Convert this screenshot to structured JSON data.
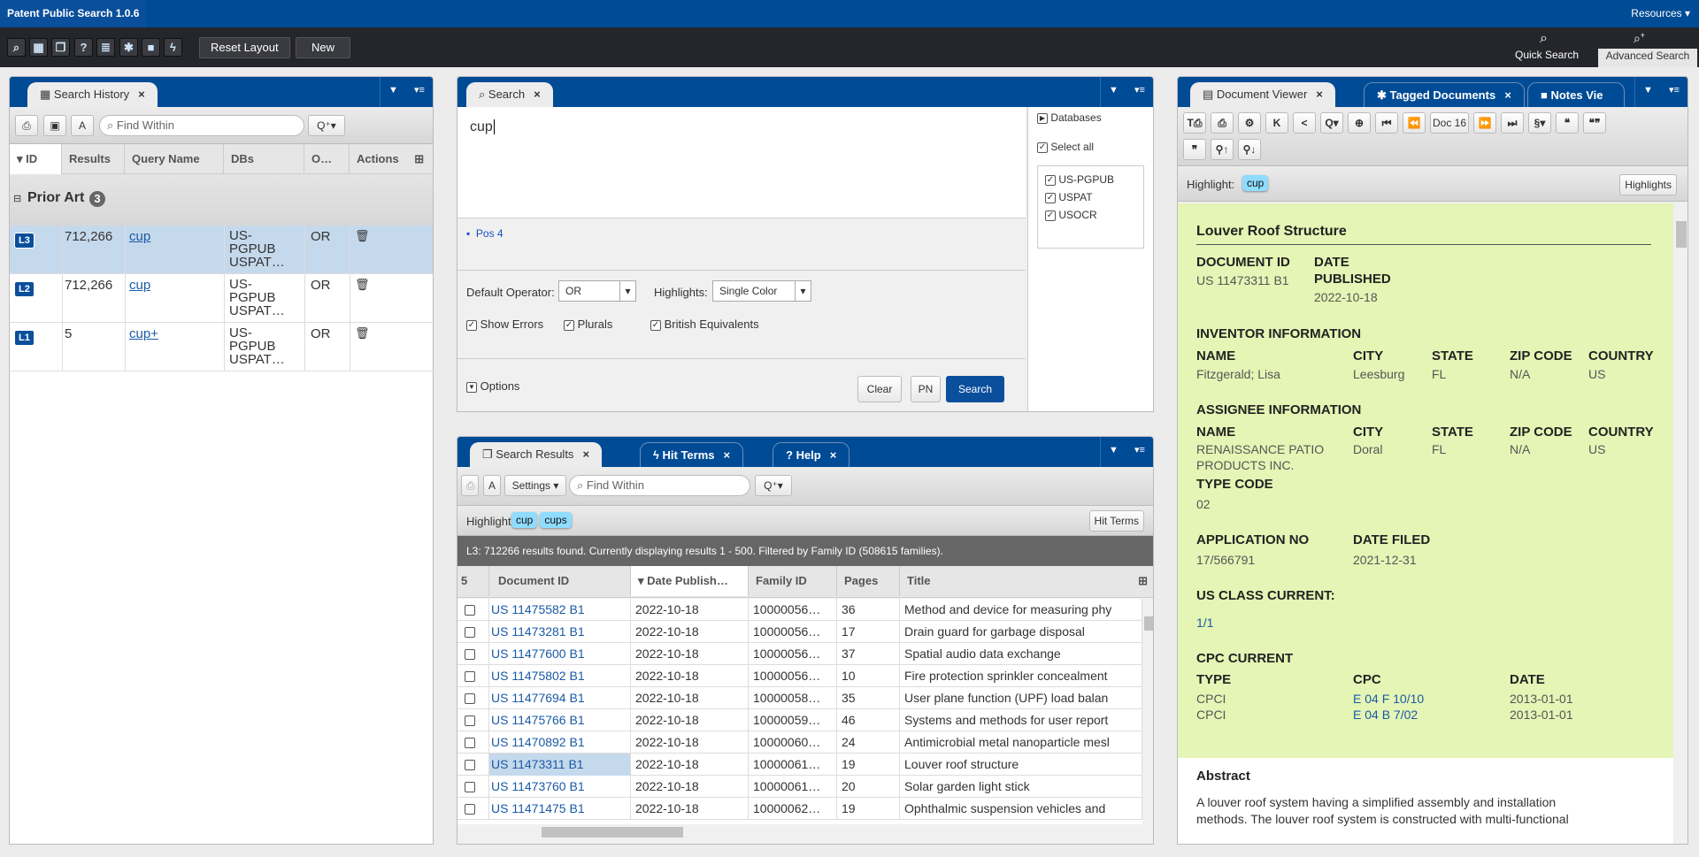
{
  "app": {
    "title": "Patent Public Search 1.0.6",
    "resources": "Resources ▾"
  },
  "toolbar": {
    "icons": [
      "search-icon",
      "search-history-icon",
      "search-results-icon",
      "help-icon",
      "document-viewer-icon",
      "tagged-documents-icon",
      "notes-icon",
      "hit-terms-icon"
    ],
    "reset_layout": "Reset Layout",
    "new": "New",
    "quick_search": "Quick Search",
    "advanced_search": "Advanced Search"
  },
  "history": {
    "tab": "Search History",
    "find_placeholder": "Find Within",
    "columns": [
      "ID",
      "Results",
      "Query Name",
      "DBs",
      "O…",
      "Actions"
    ],
    "group": "Prior Art",
    "group_count": "3",
    "rows": [
      {
        "id": "L3",
        "results": "712,266",
        "query": "cup",
        "dbs": "US-PGPUB USPAT…",
        "op": "OR",
        "selected": true
      },
      {
        "id": "L2",
        "results": "712,266",
        "query": "cup",
        "dbs": "US-PGPUB USPAT…",
        "op": "OR"
      },
      {
        "id": "L1",
        "results": "5",
        "query": "cup+",
        "dbs": "US-PGPUB USPAT…",
        "op": "OR"
      }
    ]
  },
  "search": {
    "tab": "Search",
    "query": "cup",
    "pos": "Pos 4",
    "default_operator_label": "Default Operator:",
    "default_operator": "OR",
    "highlights_label": "Highlights:",
    "highlights": "Single Color",
    "show_errors": "Show Errors",
    "plurals": "Plurals",
    "british": "British Equivalents",
    "options": "Options",
    "clear": "Clear",
    "pn": "PN",
    "search": "Search",
    "databases_label": "Databases",
    "select_all": "Select all",
    "databases": [
      "US-PGPUB",
      "USPAT",
      "USOCR"
    ]
  },
  "results": {
    "tabs": [
      "Search Results",
      "Hit Terms",
      "Help"
    ],
    "settings": "Settings",
    "find_placeholder": "Find Within",
    "highlight_label": "Highlight:",
    "highlights": [
      "cup",
      "cups"
    ],
    "hit_terms_btn": "Hit Terms",
    "status": "L3: 712266 results found. Currently displaying results 1 - 500. Filtered by Family ID (508615 families).",
    "count_col": "5",
    "columns": [
      "Document ID",
      "Date Publish…",
      "Family ID",
      "Pages",
      "Title"
    ],
    "rows": [
      [
        "US 11475582 B1",
        "2022-10-18",
        "10000056…",
        "36",
        "Method and device for measuring phy"
      ],
      [
        "US 11473281 B1",
        "2022-10-18",
        "10000056…",
        "17",
        "Drain guard for garbage disposal"
      ],
      [
        "US 11477600 B1",
        "2022-10-18",
        "10000056…",
        "37",
        "Spatial audio data exchange"
      ],
      [
        "US 11475802 B1",
        "2022-10-18",
        "10000056…",
        "10",
        "Fire protection sprinkler concealment"
      ],
      [
        "US 11477694 B1",
        "2022-10-18",
        "10000058…",
        "35",
        "User plane function (UPF) load balan"
      ],
      [
        "US 11475766 B1",
        "2022-10-18",
        "10000059…",
        "46",
        "Systems and methods for user report"
      ],
      [
        "US 11470892 B1",
        "2022-10-18",
        "10000060…",
        "24",
        "Antimicrobial metal nanoparticle mesl"
      ],
      [
        "US 11473311 B1",
        "2022-10-18",
        "10000061…",
        "19",
        "Louver roof structure"
      ],
      [
        "US 11473760 B1",
        "2022-10-18",
        "10000061…",
        "20",
        "Solar garden light stick"
      ],
      [
        "US 11471475 B1",
        "2022-10-18",
        "10000062…",
        "19",
        "Ophthalmic suspension vehicles and"
      ]
    ],
    "selected_row": 7
  },
  "viewer": {
    "tabs": [
      "Document Viewer",
      "Tagged Documents",
      "Notes Vie"
    ],
    "doc_nav": "Doc 16",
    "highlight_label": "Highlight:",
    "highlight": "cup",
    "highlights_btn": "Highlights",
    "title": "Louver Roof Structure",
    "doc_id_label": "DOCUMENT ID",
    "doc_id": "US 11473311 B1",
    "date_pub_label1": "DATE",
    "date_pub_label2": "PUBLISHED",
    "date_pub": "2022-10-18",
    "inventor_heading": "INVENTOR INFORMATION",
    "assignee_heading": "ASSIGNEE INFORMATION",
    "cols": {
      "name": "NAME",
      "city": "CITY",
      "state": "STATE",
      "zip": "ZIP CODE",
      "country": "COUNTRY"
    },
    "inventor": {
      "name": "Fitzgerald; Lisa",
      "city": "Leesburg",
      "state": "FL",
      "zip": "N/A",
      "country": "US"
    },
    "assignee": {
      "name1": "RENAISSANCE PATIO",
      "name2": "PRODUCTS INC.",
      "city": "Doral",
      "state": "FL",
      "zip": "N/A",
      "country": "US",
      "type_code_label": "TYPE CODE",
      "type_code": "02"
    },
    "app_no_label": "APPLICATION NO",
    "app_no": "17/566791",
    "date_filed_label": "DATE FILED",
    "date_filed": "2021-12-31",
    "us_class_label": "US CLASS CURRENT:",
    "us_class": "1/1",
    "cpc_heading": "CPC CURRENT",
    "cpc_cols": {
      "type": "TYPE",
      "cpc": "CPC",
      "date": "DATE"
    },
    "cpc_rows": [
      {
        "type": "CPCI",
        "cpc": "E 04 F 10/10",
        "date": "2013-01-01"
      },
      {
        "type": "CPCI",
        "cpc": "E 04 B 7/02",
        "date": "2013-01-01"
      }
    ],
    "abstract_heading": "Abstract",
    "abstract1": "A louver roof system having a simplified assembly and installation",
    "abstract2": "methods. The louver roof system is constructed with multi-functional"
  },
  "colors": {
    "brand": "#004b96",
    "toolbar": "#25262b",
    "selected": "#c5d9ec",
    "highlight": "#8fdcff",
    "doc_bg": "#e5f5b5"
  }
}
